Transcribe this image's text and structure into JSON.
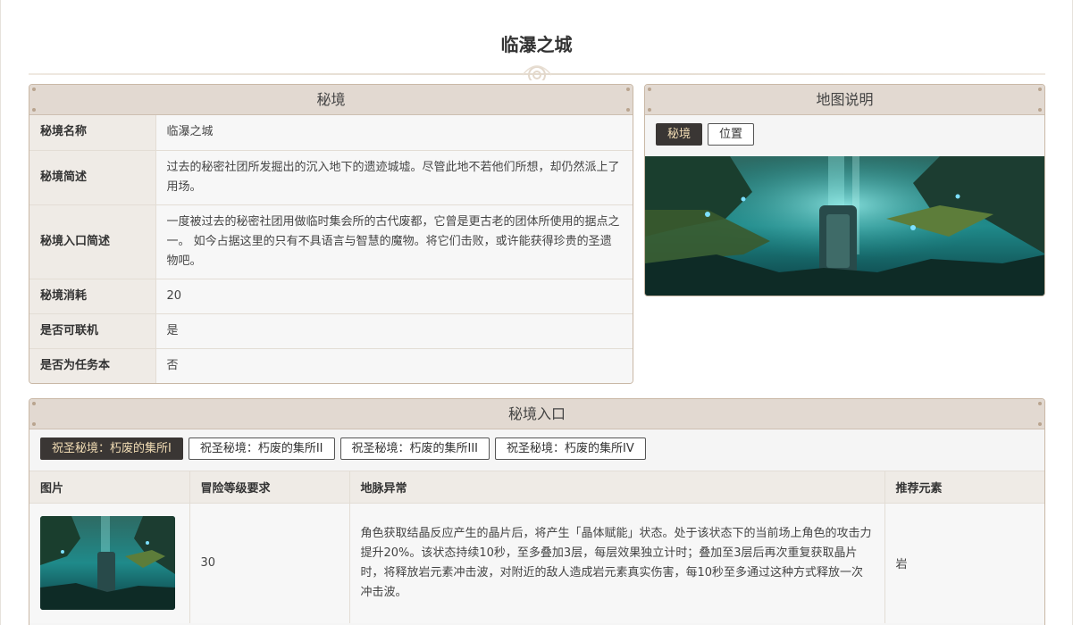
{
  "page": {
    "title": "临瀑之城"
  },
  "domain_panel": {
    "header": "秘境",
    "rows": [
      {
        "key": "秘境名称",
        "value": "临瀑之城"
      },
      {
        "key": "秘境简述",
        "value": "过去的秘密社团所发掘出的沉入地下的遗迹城墟。尽管此地不若他们所想，却仍然派上了用场。"
      },
      {
        "key": "秘境入口简述",
        "value": "一度被过去的秘密社团用做临时集会所的古代废都，它曾是更古老的团体所使用的据点之一。 如今占据这里的只有不具语言与智慧的魔物。将它们击败，或许能获得珍贵的圣遗物吧。"
      },
      {
        "key": "秘境消耗",
        "value": "20"
      },
      {
        "key": "是否可联机",
        "value": "是"
      },
      {
        "key": "是否为任务本",
        "value": "否"
      }
    ]
  },
  "map_panel": {
    "header": "地图说明",
    "tabs": [
      {
        "label": "秘境",
        "active": true
      },
      {
        "label": "位置",
        "active": false
      }
    ]
  },
  "entrance_panel": {
    "header": "秘境入口",
    "tabs": [
      {
        "label": "祝圣秘境：朽废的集所I",
        "active": true
      },
      {
        "label": "祝圣秘境：朽废的集所II",
        "active": false
      },
      {
        "label": "祝圣秘境：朽废的集所III",
        "active": false
      },
      {
        "label": "祝圣秘境：朽废的集所IV",
        "active": false
      }
    ],
    "columns": [
      "图片",
      "冒险等级要求",
      "地脉异常",
      "推荐元素"
    ],
    "row": {
      "level": "30",
      "leyline": "角色获取结晶反应产生的晶片后，将产生「晶体赋能」状态。处于该状态下的当前场上角色的攻击力提升20%。该状态持续10秒，至多叠加3层，每层效果独立计时；叠加至3层后再次重复获取晶片时，将释放岩元素冲击波，对附近的敌人造成岩元素真实伤害，每10秒至多通过这种方式释放一次冲击波。",
      "element": "岩"
    }
  },
  "colors": {
    "panel_header_bg": "#e2d9d1",
    "panel_border": "#c9b8a6",
    "active_tab_bg": "#3a3634",
    "active_tab_text": "#f1dcb4"
  }
}
